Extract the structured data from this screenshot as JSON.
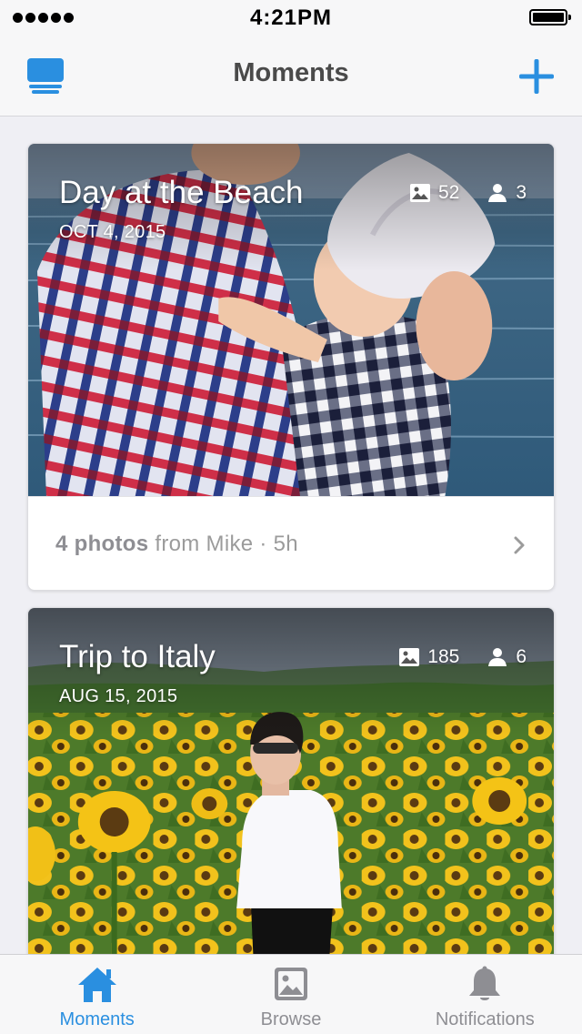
{
  "status_bar": {
    "time": "4:21PM",
    "signal_dots": 5,
    "battery_level": 1.0
  },
  "nav": {
    "title": "Moments",
    "left_icon": "stack-icon",
    "right_icon": "plus-icon",
    "accent_color": "#2a8fe0"
  },
  "moments": [
    {
      "title": "Day at the Beach",
      "date": "OCT 4, 2015",
      "photo_count": "52",
      "people_count": "3",
      "footer": {
        "count_text": "4 photos",
        "from_text": "from Mike",
        "separator": "·",
        "age": "5h"
      }
    },
    {
      "title": "Trip to Italy",
      "date": "AUG 15, 2015",
      "photo_count": "185",
      "people_count": "6"
    }
  ],
  "tabs": [
    {
      "label": "Moments",
      "icon": "home-icon",
      "active": true
    },
    {
      "label": "Browse",
      "icon": "photo-icon",
      "active": false
    },
    {
      "label": "Notifications",
      "icon": "bell-icon",
      "active": false
    }
  ]
}
